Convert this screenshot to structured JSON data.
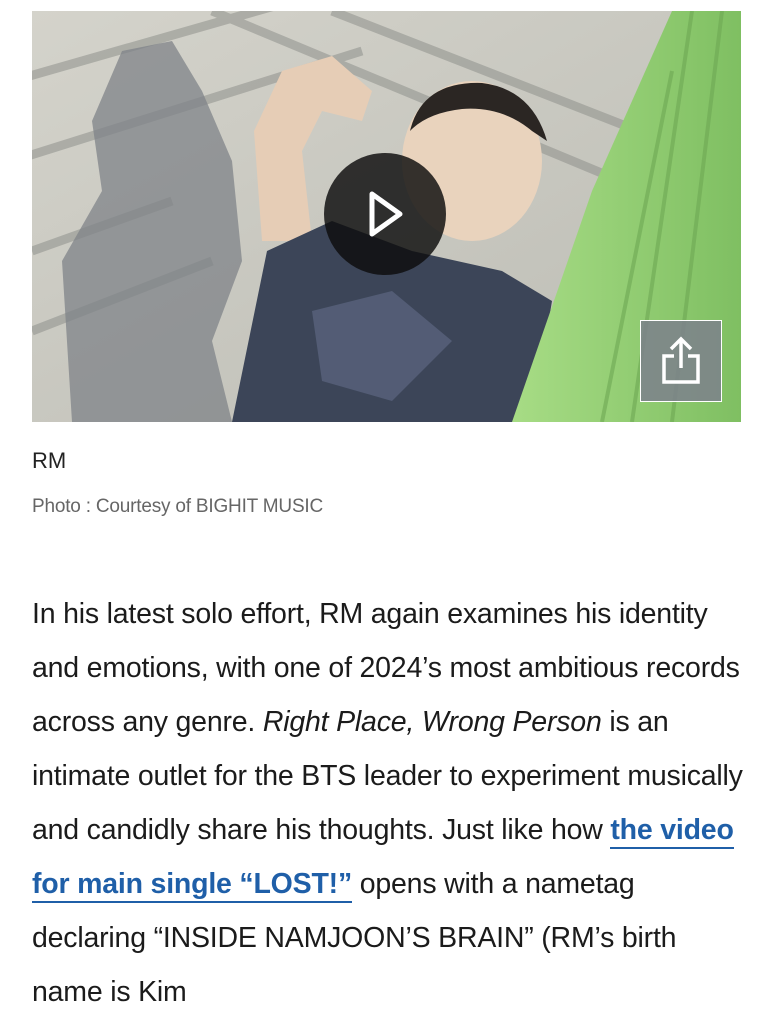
{
  "media": {
    "image_description_icon": "photo",
    "play_icon": "play-icon",
    "share_icon": "share-icon"
  },
  "caption": "RM",
  "credit": "Photo : Courtesy of BIGHIT MUSIC",
  "article": {
    "seg1": "In his latest solo effort, RM again examines his identity and emotions, with one of 2024’s most ambitious records across any genre. ",
    "seg2_italic": "Right Place, Wrong Person",
    "seg3": " is an intimate outlet for the BTS leader to experiment musically and candidly share his thoughts. Just like how ",
    "link_text": "the video for main single “LOST!”",
    "seg4": " opens with a nametag declaring “INSIDE NAMJOON’S BRAIN” (RM’s birth name is Kim"
  },
  "colors": {
    "link": "#1f5fa8",
    "hammock_green": "#9bd47a",
    "play_overlay": "#0c0c0c",
    "share_button": "#7d808c"
  }
}
